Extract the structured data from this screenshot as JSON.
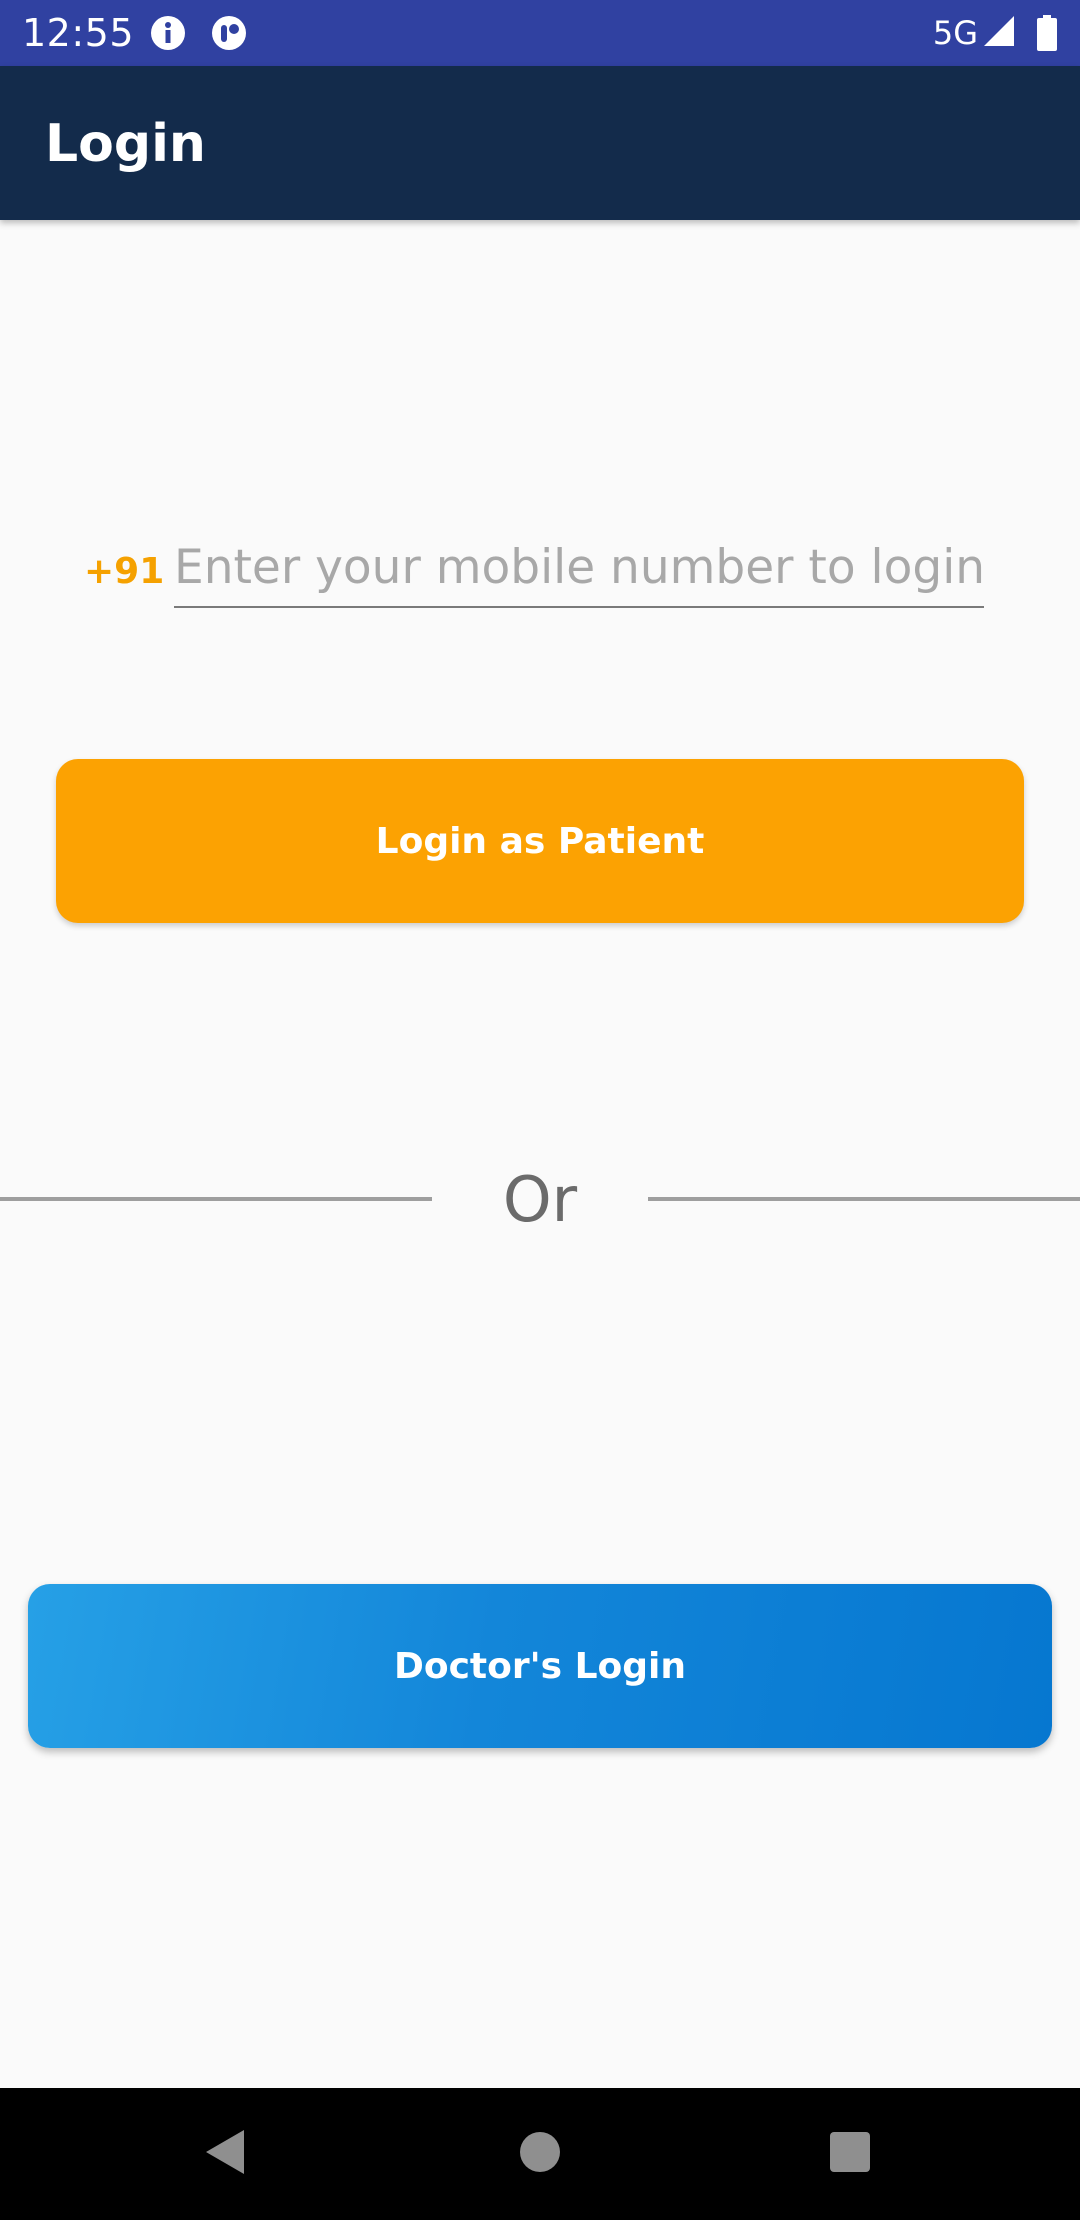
{
  "status_bar": {
    "time": "12:55",
    "network_label": "5G",
    "icons": [
      "info-icon",
      "app-notification-icon",
      "signal-icon",
      "battery-icon"
    ]
  },
  "app_bar": {
    "title": "Login"
  },
  "login_form": {
    "country_code": "+91",
    "phone_value": "",
    "phone_placeholder": "Enter your mobile number to login",
    "patient_button_label": "Login as Patient"
  },
  "divider": {
    "label": "Or"
  },
  "doctor": {
    "button_label": "Doctor's Login"
  },
  "nav_bar": {
    "icons": [
      "back-icon",
      "home-icon",
      "recents-icon"
    ]
  },
  "colors": {
    "status_bar": "#3041a1",
    "app_bar": "#132b4b",
    "accent_orange": "#fca202",
    "doctor_blue": "#0677d0",
    "background": "#fafafa"
  }
}
